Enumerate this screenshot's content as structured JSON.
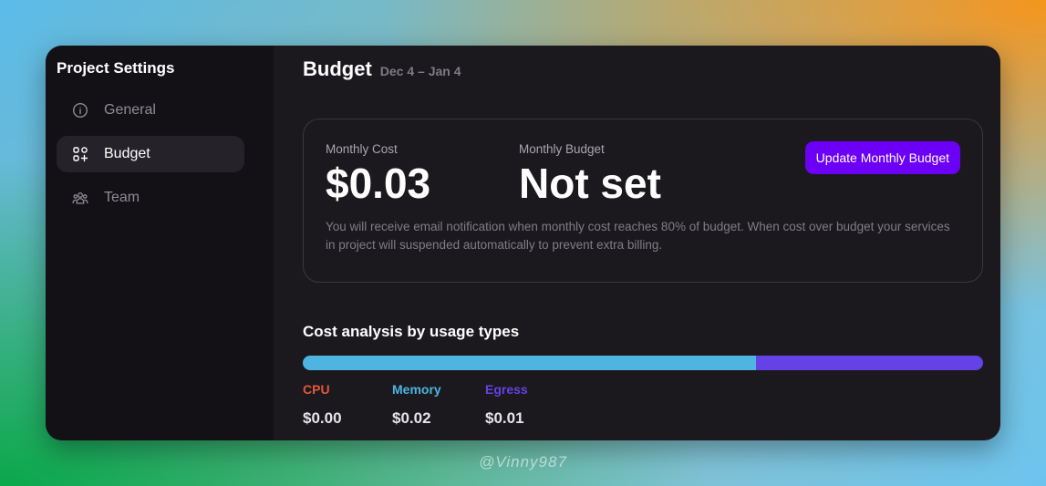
{
  "sidebar": {
    "title": "Project Settings",
    "items": [
      {
        "label": "General",
        "icon": "info-icon",
        "active": false
      },
      {
        "label": "Budget",
        "icon": "apps-add-icon",
        "active": true
      },
      {
        "label": "Team",
        "icon": "team-icon",
        "active": false
      }
    ]
  },
  "header": {
    "title": "Budget",
    "date_range": "Dec 4 – Jan 4"
  },
  "budget_card": {
    "monthly_cost_label": "Monthly Cost",
    "monthly_cost_value": "$0.03",
    "monthly_budget_label": "Monthly Budget",
    "monthly_budget_value": "Not set",
    "update_button": "Update Monthly Budget",
    "note": "You will receive email notification when monthly cost reaches 80% of budget. When cost over budget your services in project will suspended automatically to prevent extra billing."
  },
  "usage": {
    "title": "Cost analysis by usage types",
    "types": [
      {
        "label": "CPU",
        "value": "$0.00",
        "amount": 0.0,
        "color": "#e2573a"
      },
      {
        "label": "Memory",
        "value": "$0.02",
        "amount": 0.02,
        "color": "#4db5df"
      },
      {
        "label": "Egress",
        "value": "$0.01",
        "amount": 0.01,
        "color": "#6442e6"
      }
    ]
  },
  "watermark": "@Vinny987",
  "colors": {
    "accent": "#6c00f6",
    "window_bg": "#1b191e",
    "sidebar_bg": "#131115"
  }
}
